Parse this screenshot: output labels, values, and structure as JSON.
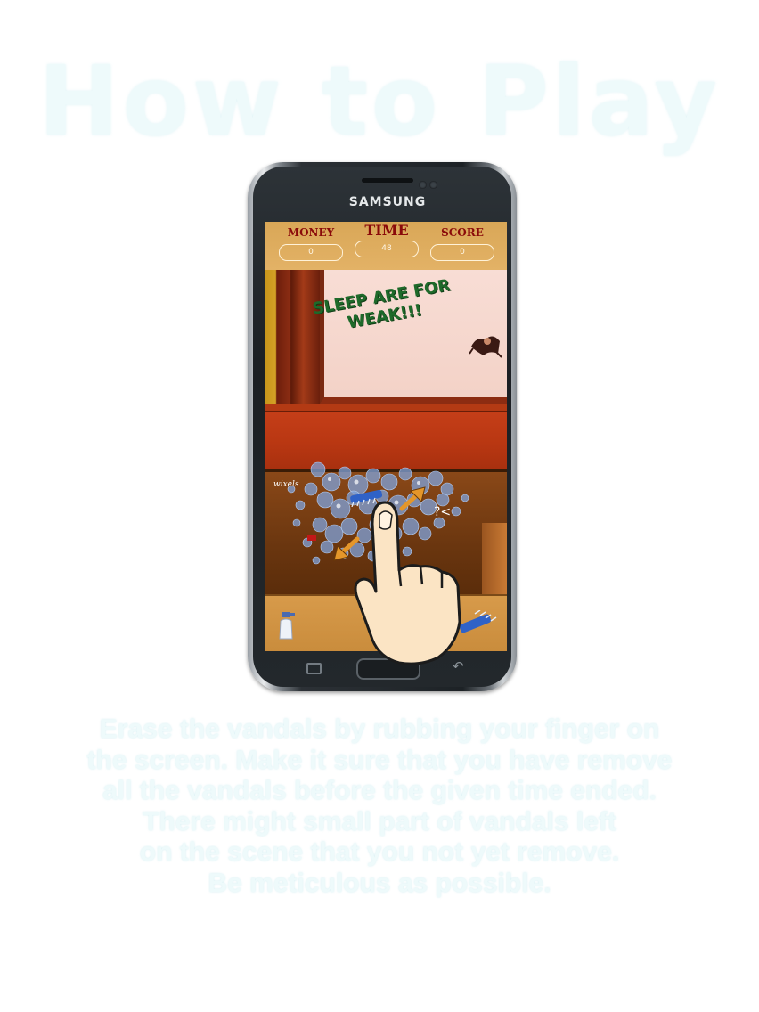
{
  "page_title": "How to Play",
  "phone": {
    "brand": "SAMSUNG"
  },
  "hud": {
    "money_label": "MONEY",
    "money_value": "0",
    "time_label": "TIME",
    "time_value": "48",
    "score_label": "SCORE",
    "score_value": "0"
  },
  "scene": {
    "graffiti_line1": "SLEEP ARE FOR",
    "graffiti_line2": "WEAK!!!"
  },
  "instructions": [
    "Erase the vandals by rubbing your finger on",
    "the screen. Make it sure that you have remove",
    "all the vandals before the given time ended.",
    "There might small part of vandals left",
    "on the scene that you not yet remove.",
    "Be meticulous as possible."
  ],
  "colors": {
    "title": "#eefafb",
    "instructions": "#eefafb",
    "hud_label": "#8a0a0a",
    "graffiti": "#1e6a2a"
  },
  "icons": [
    "spray-bottle-icon",
    "brush-icon",
    "finger-hand-icon",
    "arrow-icon"
  ]
}
